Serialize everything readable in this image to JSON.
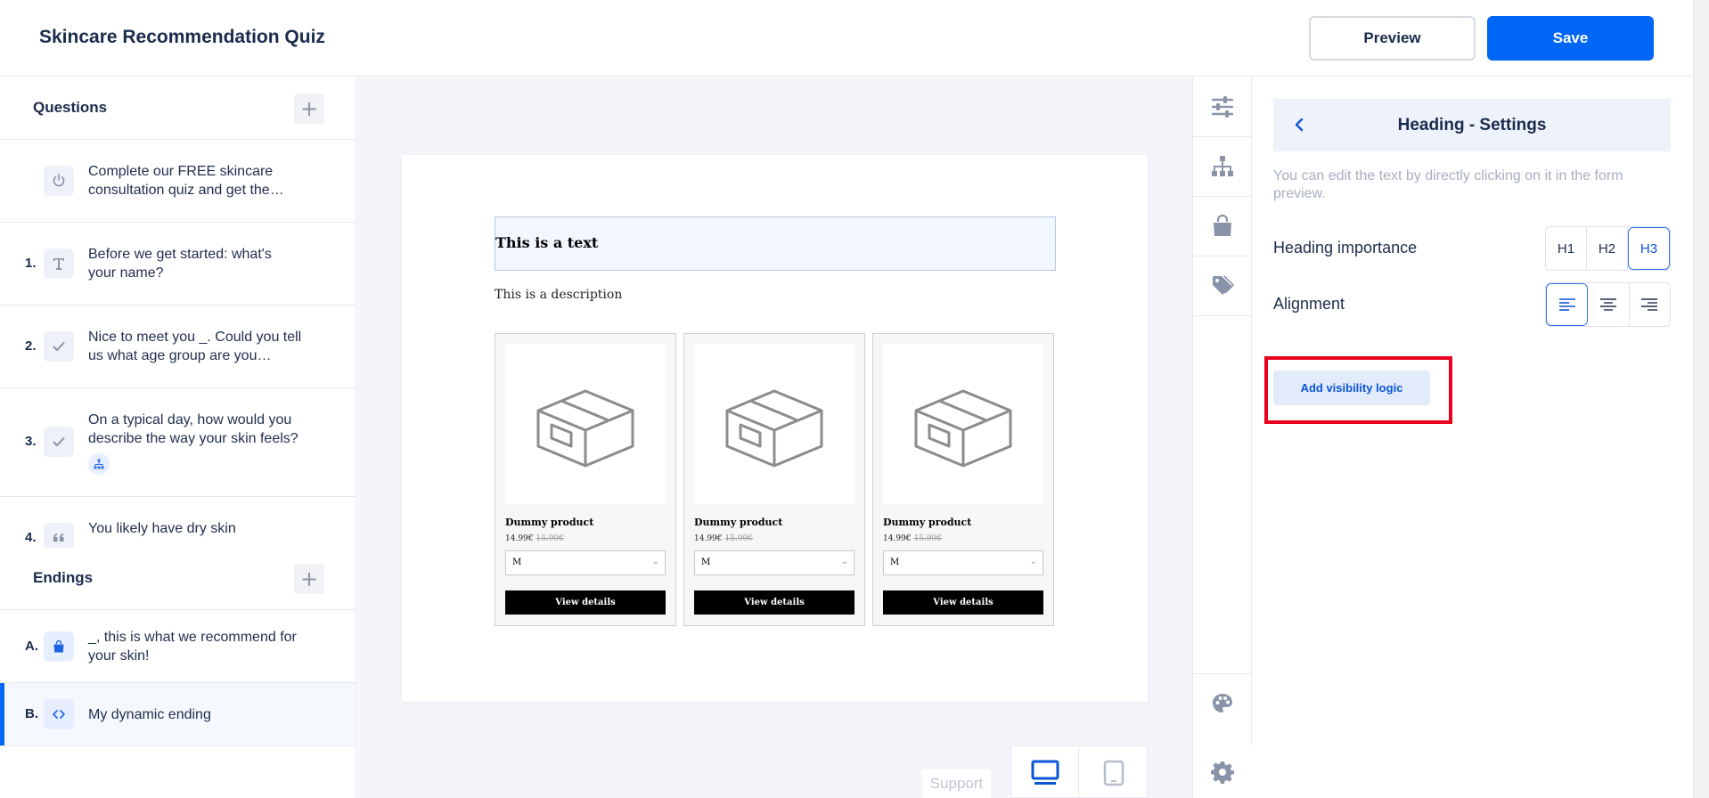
{
  "header": {
    "title": "Skincare Recommendation Quiz",
    "preview_label": "Preview",
    "save_label": "Save"
  },
  "questions": {
    "title": "Questions",
    "items": [
      {
        "num": "",
        "text": "Complete our FREE skincare consultation quiz and get the…",
        "icon": "power-icon"
      },
      {
        "num": "1.",
        "text": "Before we get started: what's your name?",
        "icon": "text-icon"
      },
      {
        "num": "2.",
        "text": "Nice to meet you _. Could you tell us what age group are you…",
        "icon": "check-icon"
      },
      {
        "num": "3.",
        "text": "On a typical day, how would you describe the way your skin feels?",
        "icon": "check-icon",
        "badge": "branch-logic-icon"
      },
      {
        "num": "4.",
        "text": "You likely have dry skin",
        "icon": "quote-icon"
      }
    ]
  },
  "endings": {
    "title": "Endings",
    "items": [
      {
        "num": "A.",
        "text": "_, this is what we recommend for your skin!",
        "icon": "shopping-bag-icon"
      },
      {
        "num": "B.",
        "text": "My dynamic ending",
        "icon": "code-icon"
      }
    ]
  },
  "canvas": {
    "heading": "This is a text",
    "description": "This is a description",
    "products": [
      {
        "name": "Dummy product",
        "price": "14.99€",
        "old_price": "15.99€",
        "size": "M",
        "button": "View details"
      },
      {
        "name": "Dummy product",
        "price": "14.99€",
        "old_price": "15.99€",
        "size": "M",
        "button": "View details"
      },
      {
        "name": "Dummy product",
        "price": "14.99€",
        "old_price": "15.99€",
        "size": "M",
        "button": "View details"
      }
    ],
    "support_label": "Support"
  },
  "settings": {
    "title": "Heading - Settings",
    "hint": "You can edit the text by directly clicking on it in the form preview.",
    "importance_label": "Heading importance",
    "importance_options": [
      "H1",
      "H2",
      "H3"
    ],
    "importance_selected": "H3",
    "alignment_label": "Alignment",
    "alignment_selected": "left",
    "visibility_button": "Add visibility logic"
  },
  "colors": {
    "accent": "#0066f5",
    "highlight": "#e8001c"
  }
}
